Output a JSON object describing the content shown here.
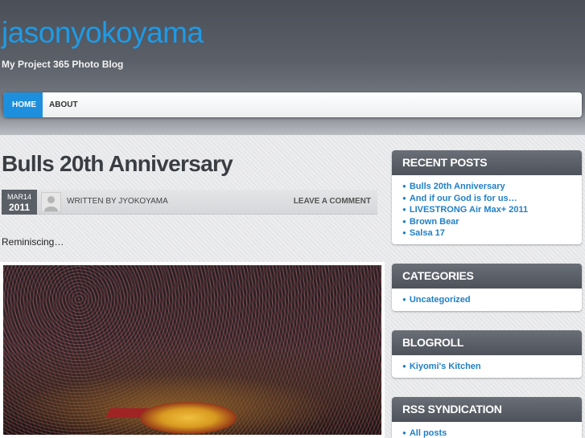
{
  "site": {
    "title": "jasonyokoyama",
    "description": "My Project 365 Photo Blog"
  },
  "nav": {
    "items": [
      {
        "label": "HOME",
        "active": true
      },
      {
        "label": "ABOUT",
        "active": false
      }
    ]
  },
  "post": {
    "title": "Bulls 20th Anniversary",
    "date_month_day": "MAR14",
    "date_year": "2011",
    "written_by": "WRITTEN BY JYOKOYAMA",
    "leave_comment": "LEAVE A COMMENT",
    "excerpt": "Reminiscing…"
  },
  "sidebar": {
    "recent_posts": {
      "title": "RECENT POSTS",
      "items": [
        "Bulls 20th Anniversary",
        "And if our God is for us…",
        "LIVESTRONG Air Max+ 2011",
        "Brown Bear",
        "Salsa 17"
      ]
    },
    "categories": {
      "title": "CATEGORIES",
      "items": [
        "Uncategorized"
      ]
    },
    "blogroll": {
      "title": "BLOGROLL",
      "items": [
        "Kiyomi's Kitchen"
      ]
    },
    "rss": {
      "title": "RSS SYNDICATION",
      "items": [
        "All posts"
      ]
    }
  },
  "colors": {
    "accent": "#1e8fdd",
    "link": "#1f7fc6",
    "widget_header": "#5b5f66"
  }
}
